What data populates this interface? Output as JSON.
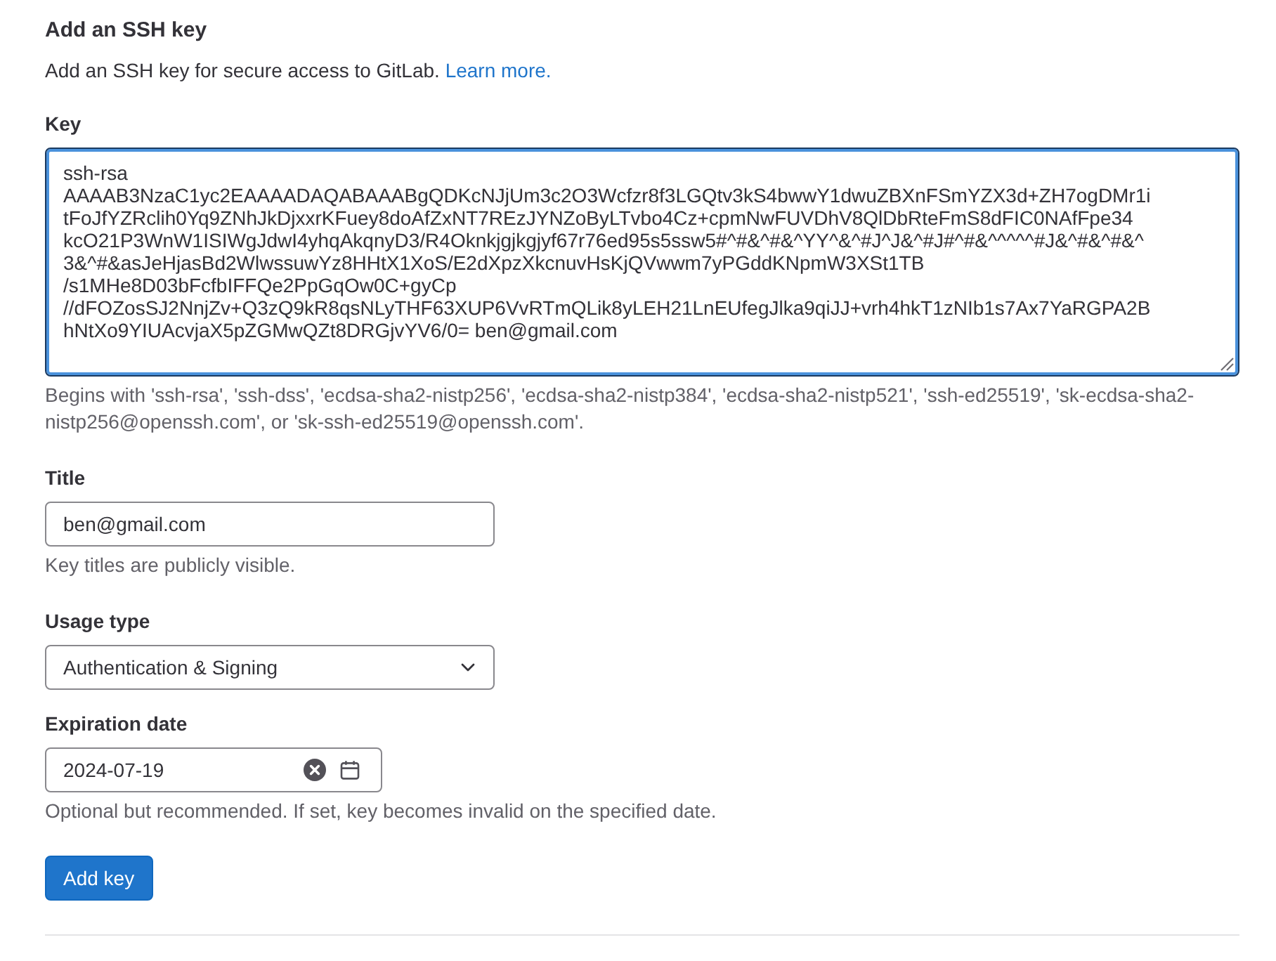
{
  "heading": "Add an SSH key",
  "intro": {
    "text": "Add an SSH key for secure access to GitLab. ",
    "link": "Learn more."
  },
  "fields": [
    {
      "kind": "textarea",
      "label": "Key",
      "focused": true,
      "value": "ssh-rsa\nAAAAB3NzaC1yc2EAAAADAQABAAABgQDKcNJjUm3c2O3Wcfzr8f3LGQtv3kS4bwwY1dwuZBXnFSmYZX3d+ZH7ogDMr1i\ntFoJfYZRclih0Yq9ZNhJkDjxxrKFuey8doAfZxNT7REzJYNZoByLTvbo4Cz+cpmNwFUVDhV8QlDbRteFmS8dFIC0NAfFpe34\nkcO21P3WnW1ISIWgJdwI4yhqAkqnyD3/R4Oknkjgjkgjyf67r76ed95s5ssw5#^#&^#&^YY^&^#J^J&^#J#^#&^^^^^#J&^#&^#&^\n3&^#&asJeHjasBd2WlwssuwYz8HHtX1XoS/E2dXpzXkcnuvHsKjQVwwm7yPGddKNpmW3XSt1TB\n/s1MHe8D03bFcfbIFFQe2PpGqOw0C+gyCp\n//dFOZosSJ2NnjZv+Q3zQ9kR8qsNLyTHF63XUP6VvRTmQLik8yLEH21LnEUfegJlka9qiJJ+vrh4hkT1zNIb1s7Ax7YaRGPA2B\nhNtXo9YIUAcvjaX5pZGMwQZt8DRGjvYV6/0= ben@gmail.com",
      "hint": "Begins with 'ssh-rsa', 'ssh-dss', 'ecdsa-sha2-nistp256', 'ecdsa-sha2-nistp384', 'ecdsa-sha2-nistp521', 'ssh-ed25519', 'sk-ecdsa-sha2-nistp256@openssh.com', or 'sk-ssh-ed25519@openssh.com'."
    },
    {
      "kind": "text",
      "label": "Title",
      "focused": false,
      "value": "ben@gmail.com",
      "hint": "Key titles are publicly visible."
    },
    {
      "kind": "select",
      "label": "Usage type",
      "focused": false,
      "value": "Authentication & Signing"
    },
    {
      "kind": "date",
      "label": "Expiration date",
      "focused": false,
      "value": "2024-07-19",
      "hint": "Optional but recommended. If set, key becomes invalid on the specified date."
    }
  ],
  "submit_button": "Add key"
}
